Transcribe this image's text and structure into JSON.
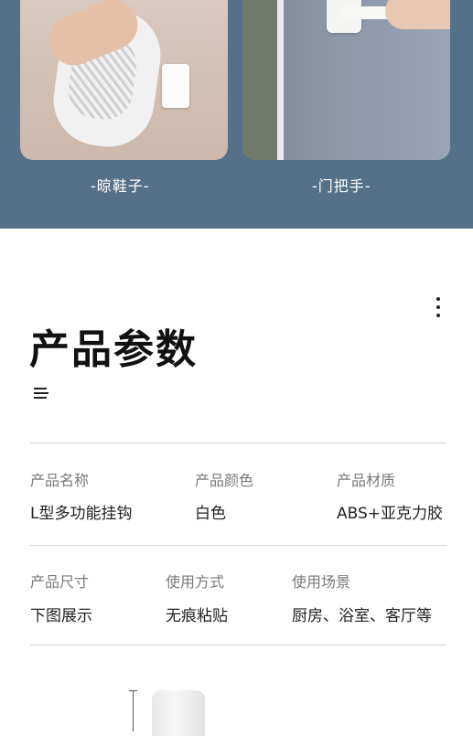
{
  "gallery": {
    "left_caption": "-晾鞋子-",
    "right_caption": "-门把手-"
  },
  "section": {
    "title": "产品参数"
  },
  "specs": {
    "row1": [
      {
        "label": "产品名称",
        "value": "L型多功能挂钩"
      },
      {
        "label": "产品颜色",
        "value": "白色"
      },
      {
        "label": "产品材质",
        "value": "ABS+亚克力胶"
      }
    ],
    "row2": [
      {
        "label": "产品尺寸",
        "value": "下图展示"
      },
      {
        "label": "使用方式",
        "value": "无痕粘贴"
      },
      {
        "label": "使用场景",
        "value": "厨房、浴室、客厅等"
      }
    ]
  },
  "colors": {
    "band": "#557189",
    "text": "#222222",
    "label": "#7a7a7a"
  },
  "icons": {
    "more": "kebab-vertical-icon",
    "menu": "hamburger-menu-icon"
  }
}
